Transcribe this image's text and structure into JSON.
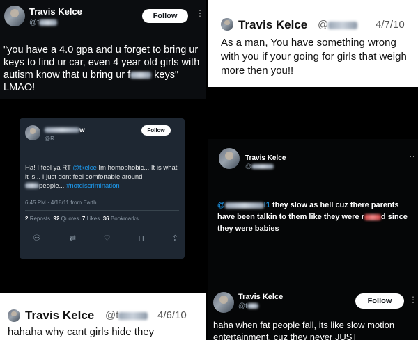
{
  "tweet1": {
    "name": "Travis Kelce",
    "handle_prefix": "@t",
    "follow_label": "Follow",
    "body": "\"you have a 4.0 gpa and u forget to bring ur keys to find ur car, even 4 year old girls with autism know that u bring ur f",
    "body_end": " keys\" LMAO!"
  },
  "tweet2": {
    "name": "Travis Kelce",
    "handle_prefix": "@",
    "date": "4/7/10",
    "body": "As a man, You have something wrong with you if your going for girls that weigh more then you!!"
  },
  "tweet3": {
    "name_suffix": "w",
    "handle_prefix": "@R",
    "follow_label": "Follow",
    "body_start": "Ha! I feel ya RT ",
    "mention": "@tkelce",
    "body_mid": " Im homophobic... It is what it is... I just dont feel comfortable around",
    "body_people": "people... ",
    "hashtag": "#notdiscrimination",
    "timestamp": "6:45 PM · 4/18/11 from Earth",
    "stats": {
      "reposts_num": "2",
      "reposts_label": "Reposts",
      "quotes_num": "92",
      "quotes_label": "Quotes",
      "likes_num": "7",
      "likes_label": "Likes",
      "bookmarks_num": "36",
      "bookmarks_label": "Bookmarks"
    }
  },
  "tweet4": {
    "name": "Travis Kelce",
    "handle_prefix": "@",
    "mention_prefix": "@",
    "mention_suffix": "l1",
    "body_1": " they slow as hell cuz there parents have been talkin to them like they were r",
    "body_2": "d since they were babies"
  },
  "tweet5": {
    "name": "Travis Kelce",
    "handle_prefix": "@t",
    "date": "4/6/10",
    "body": "hahaha why cant girls hide they"
  },
  "tweet6": {
    "name": "Travis Kelce",
    "handle_prefix": "@t",
    "follow_label": "Follow",
    "body": "haha when fat people fall, its like slow motion entertainment, cuz they never JUST"
  },
  "colors": {
    "link": "#1d9bf0",
    "follow_bg": "#ffffff",
    "follow_text": "#0f1419"
  },
  "icons": [
    "more-icon",
    "reply-icon",
    "repost-icon",
    "like-icon",
    "bookmark-icon",
    "share-icon"
  ]
}
